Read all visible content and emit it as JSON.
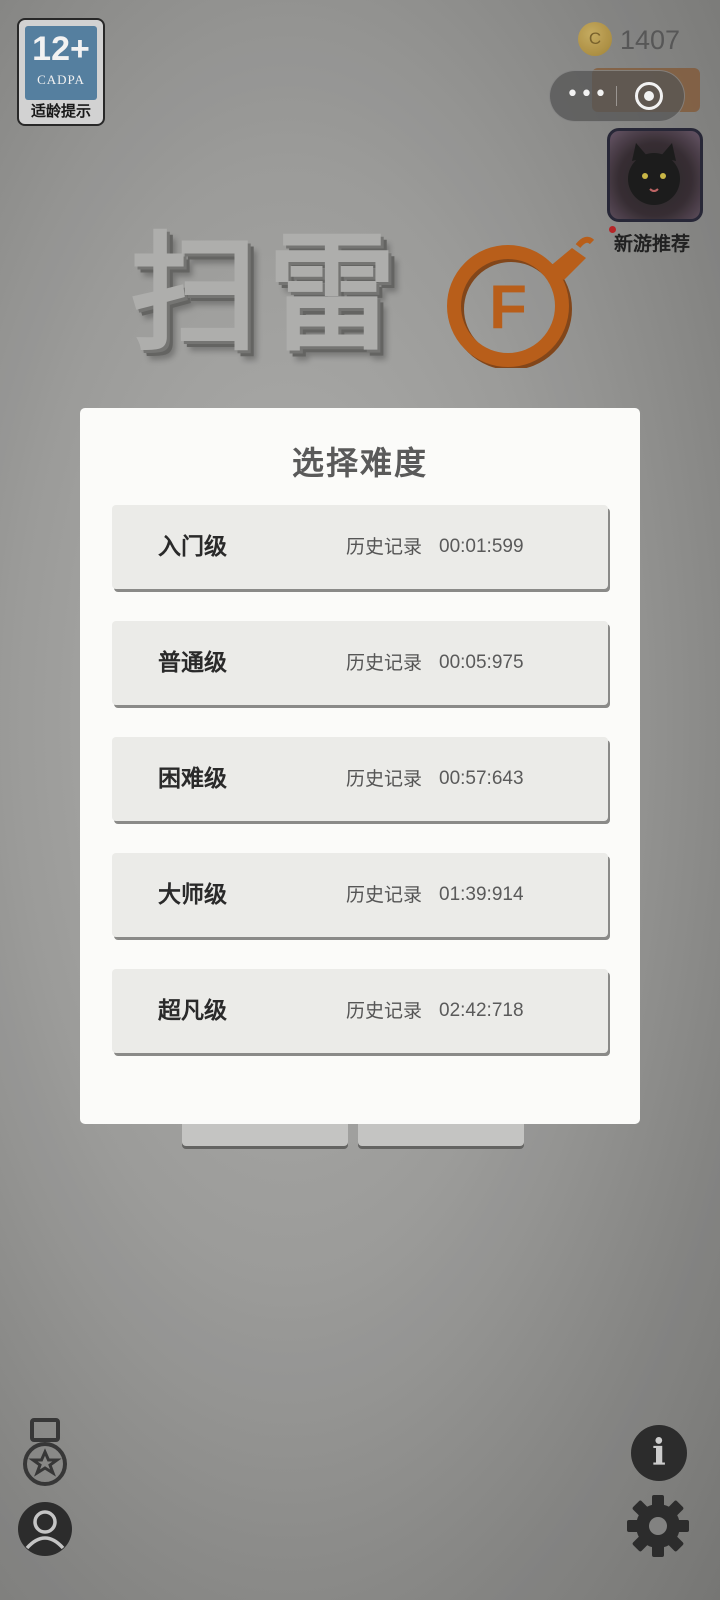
{
  "age_rating": {
    "number": "12+",
    "org": "CADPA",
    "label": "适龄提示"
  },
  "coins": {
    "icon": "coin-icon",
    "symbol": "C",
    "count": "1407"
  },
  "capsule": {
    "more": "•••"
  },
  "recommend": {
    "label": "新游推荐"
  },
  "logo": {
    "text": "扫雷",
    "badge": "F",
    "accent": "#c2641c"
  },
  "modal": {
    "title": "选择难度",
    "levels": [
      {
        "name": "入门级",
        "record_label": "历史记录",
        "record_time": "00:01:599"
      },
      {
        "name": "普通级",
        "record_label": "历史记录",
        "record_time": "00:05:975"
      },
      {
        "name": "困难级",
        "record_label": "历史记录",
        "record_time": "00:57:643"
      },
      {
        "name": "大师级",
        "record_label": "历史记录",
        "record_time": "01:39:914"
      },
      {
        "name": "超凡级",
        "record_label": "历史记录",
        "record_time": "02:42:718"
      }
    ]
  },
  "bottom_icons": {
    "left": [
      "medal-icon",
      "user-icon"
    ],
    "right": [
      "info-icon",
      "gear-icon"
    ],
    "info_symbol": "i"
  }
}
